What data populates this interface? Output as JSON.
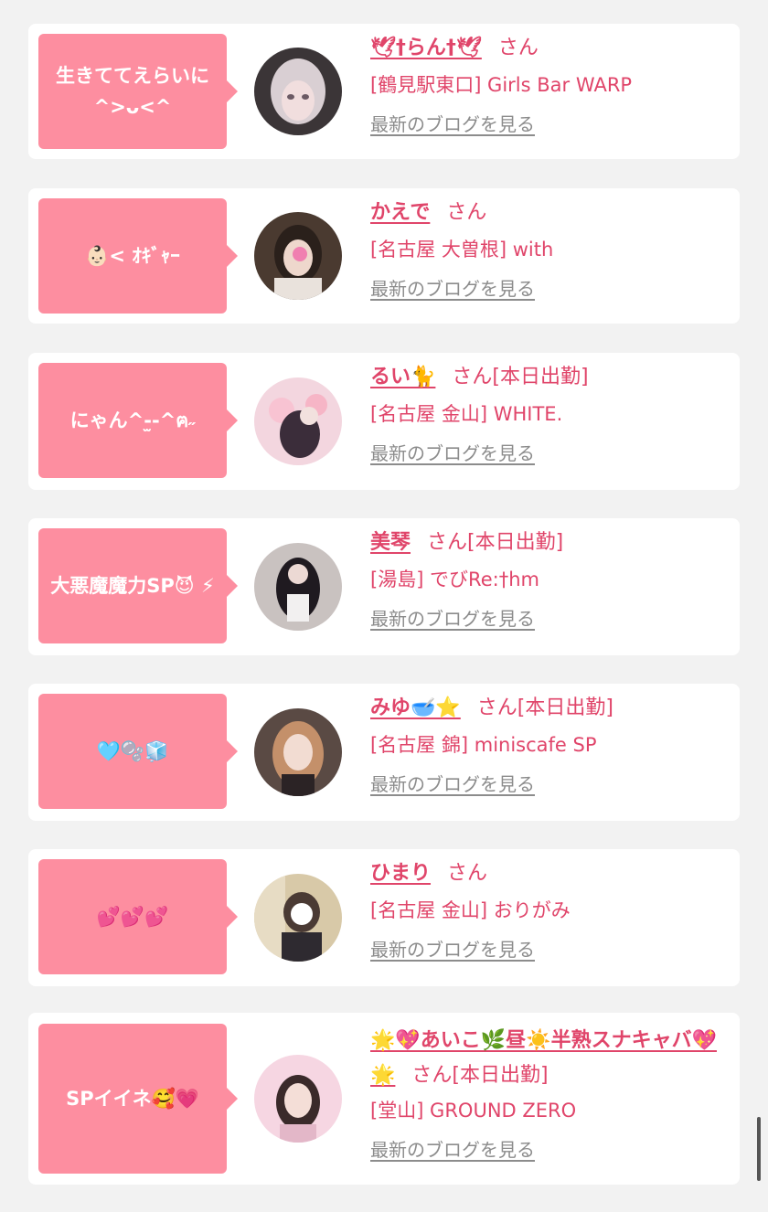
{
  "colors": {
    "background": "#f2f2f2",
    "card": "#ffffff",
    "bubble": "#fd8ea0",
    "accent": "#e0456a",
    "link_gray": "#8c8c8c"
  },
  "items": [
    {
      "bubble": "生きててえらいに ^>ᴗ<^",
      "name": "🕊†らん†🕊",
      "san": "さん",
      "shop": "[鶴見駅東口] Girls Bar WARP",
      "blog": "最新のブログを見る"
    },
    {
      "bubble": "👶🏻< ｵｷﾞｬｰ",
      "name": "かえで",
      "san": "さん",
      "shop": "[名古屋 大曽根] with",
      "blog": "最新のブログを見る"
    },
    {
      "bubble": "にゃん^-̫-^ฅ˶",
      "name": "るい🐈",
      "san": "さん[本日出勤]",
      "shop": "[名古屋 金山] WHITE.",
      "blog": "最新のブログを見る"
    },
    {
      "bubble": "大悪魔魔力SP😈 ⚡",
      "name": "美琴",
      "san": "さん[本日出勤]",
      "shop": "[湯島] でびRe:†hm",
      "blog": "最新のブログを見る"
    },
    {
      "bubble": "🩵🫧🧊",
      "name": "みゆ🥣⭐",
      "san": "さん[本日出勤]",
      "shop": "[名古屋 錦] miniscafe SP",
      "blog": "最新のブログを見る"
    },
    {
      "bubble": "💕💕💕",
      "name": "ひまり",
      "san": "さん",
      "shop": "[名古屋 金山] おりがみ",
      "blog": "最新のブログを見る"
    },
    {
      "bubble": "SPイイネ🥰💗",
      "name": "🌟💖あいこ🌿昼☀️半熟スナキャバ💖🌟",
      "san": "さん[本日出勤]",
      "shop": "[堂山] GROUND ZERO",
      "blog": "最新のブログを見る"
    }
  ]
}
